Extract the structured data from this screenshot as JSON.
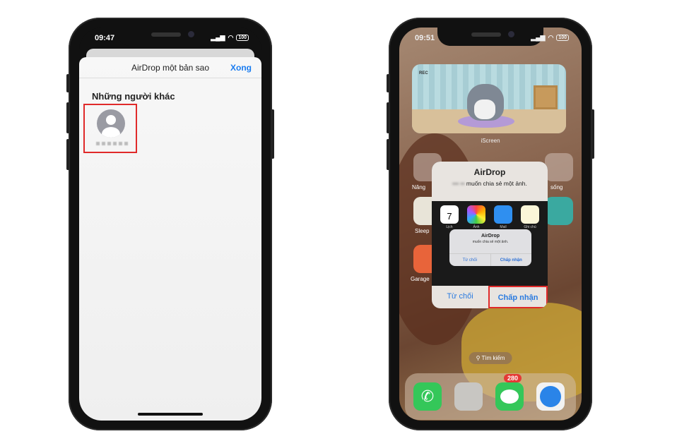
{
  "left_phone": {
    "status": {
      "time": "09:47",
      "battery": "100"
    },
    "sheet": {
      "title": "AirDrop một bản sao",
      "done_label": "Xong",
      "section": "Những người khác"
    }
  },
  "right_phone": {
    "status": {
      "time": "09:51",
      "battery": "100"
    },
    "widget": {
      "rec": "REC",
      "label": "iScreen"
    },
    "app_labels": {
      "left_top": "Năng",
      "right_top": "sống",
      "left_mid": "Sleep",
      "left_bottom": "Garage"
    },
    "alert": {
      "title": "AirDrop",
      "message": "muốn chia sẻ một ảnh.",
      "preview": {
        "apps": [
          "Lịch",
          "Ảnh",
          "Mail",
          "Ghi chú"
        ],
        "calendar_day": "7",
        "inner_title": "AirDrop",
        "inner_message": "muốn chia sẻ một ảnh.",
        "inner_decline": "Từ chối",
        "inner_accept": "Chấp nhận"
      },
      "decline_label": "Từ chối",
      "accept_label": "Chấp nhận"
    },
    "search_label": "Tìm kiếm",
    "dock": {
      "apps": [
        "phone-icon",
        "contacts-icon",
        "messages-icon",
        "safari-icon"
      ],
      "messages_badge": "280"
    }
  },
  "colors": {
    "highlight": "#e02a2a",
    "ios_blue": "#1a7cf0"
  }
}
